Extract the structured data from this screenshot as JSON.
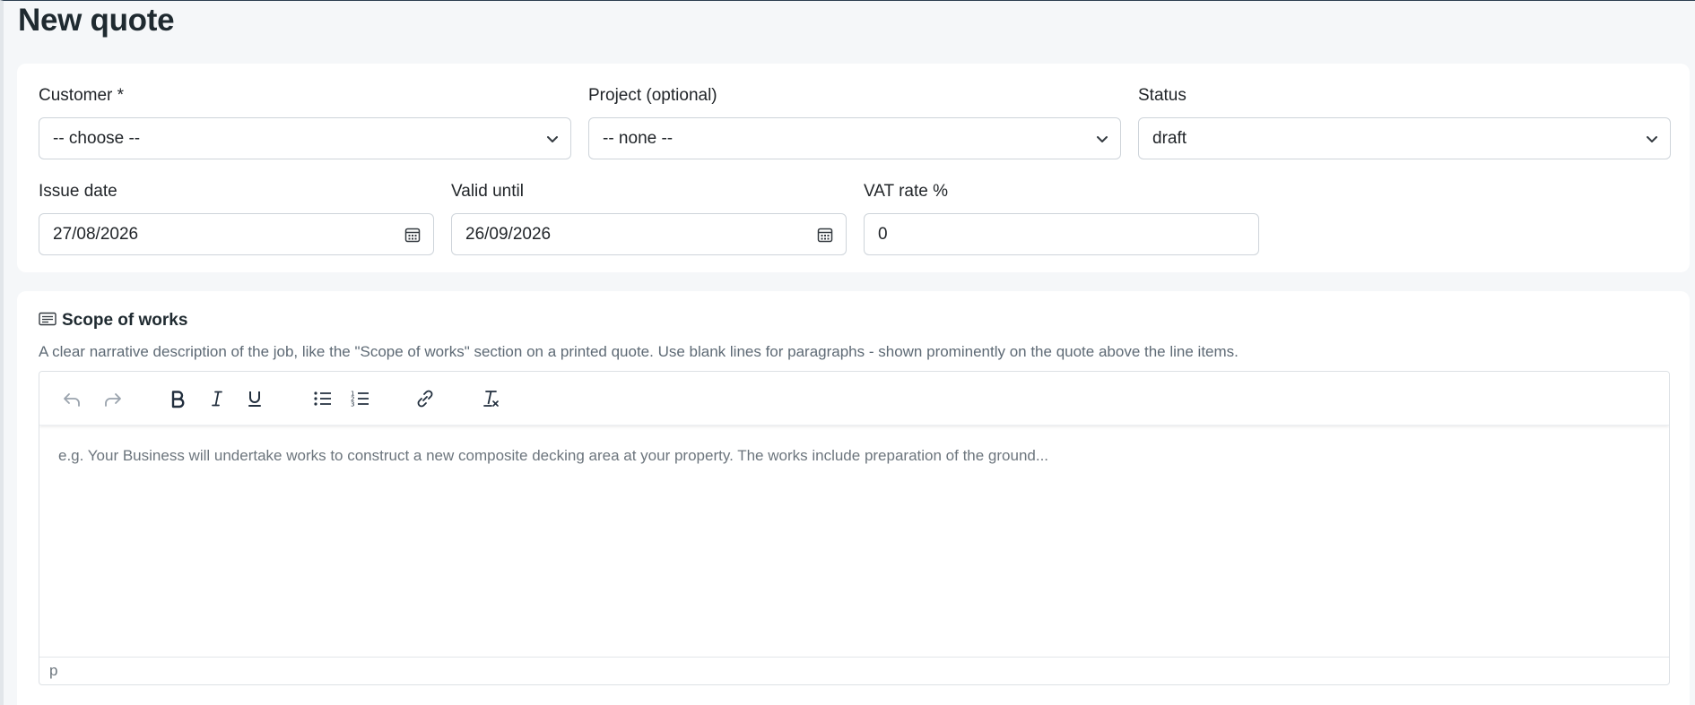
{
  "page": {
    "title": "New quote"
  },
  "form": {
    "customer": {
      "label": "Customer *",
      "value": "-- choose --"
    },
    "project": {
      "label": "Project (optional)",
      "value": "-- none --"
    },
    "status": {
      "label": "Status",
      "value": "draft"
    },
    "issue_date": {
      "label": "Issue date",
      "value": "27/08/2026"
    },
    "valid_until": {
      "label": "Valid until",
      "value": "26/09/2026"
    },
    "vat_rate": {
      "label": "VAT rate %",
      "value": "0"
    }
  },
  "scope": {
    "title": "Scope of works",
    "help": "A clear narrative description of the job, like the \"Scope of works\" section on a printed quote. Use blank lines for paragraphs - shown prominently on the quote above the line items.",
    "placeholder": "e.g. Your Business will undertake works to construct a new composite decking area at your property. The works include preparation of the ground...",
    "statusbar_path": "p",
    "toolbar": [
      "undo-icon",
      "redo-icon",
      "bold-icon",
      "italic-icon",
      "underline-icon",
      "bullet-list-icon",
      "numbered-list-icon",
      "link-icon",
      "clear-formatting-icon"
    ]
  },
  "colors": {
    "background": "#f5f7f9",
    "card": "#ffffff",
    "border": "#ced4da",
    "muted_text": "#5e6a75"
  }
}
